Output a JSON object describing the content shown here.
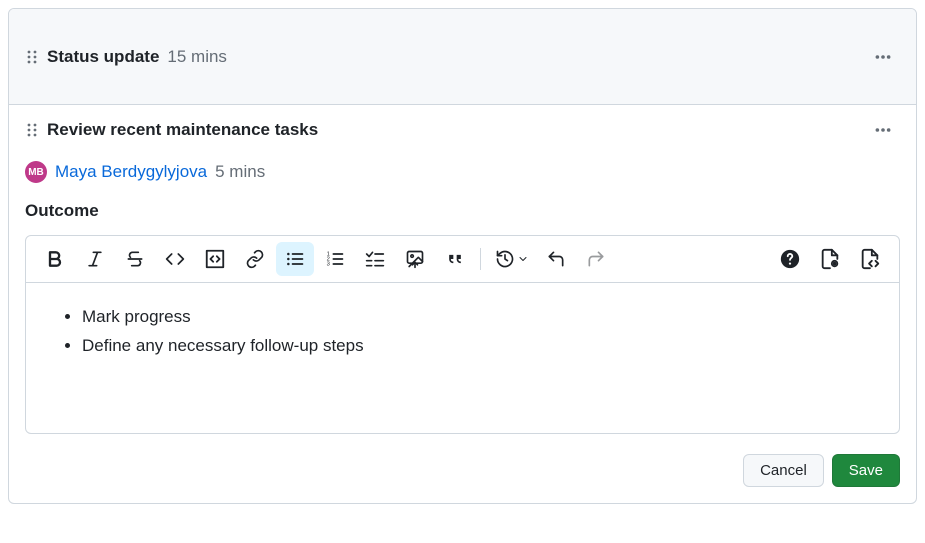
{
  "items": [
    {
      "title": "Status update",
      "duration": "15 mins"
    },
    {
      "title": "Review recent maintenance tasks",
      "duration": "5 mins",
      "assignee": {
        "initials": "MB",
        "name": "Maya Berdygylyjova"
      },
      "section_label": "Outcome",
      "content": {
        "bullets": [
          "Mark progress",
          "Define any necessary follow-up steps"
        ]
      }
    }
  ],
  "actions": {
    "cancel": "Cancel",
    "save": "Save"
  }
}
